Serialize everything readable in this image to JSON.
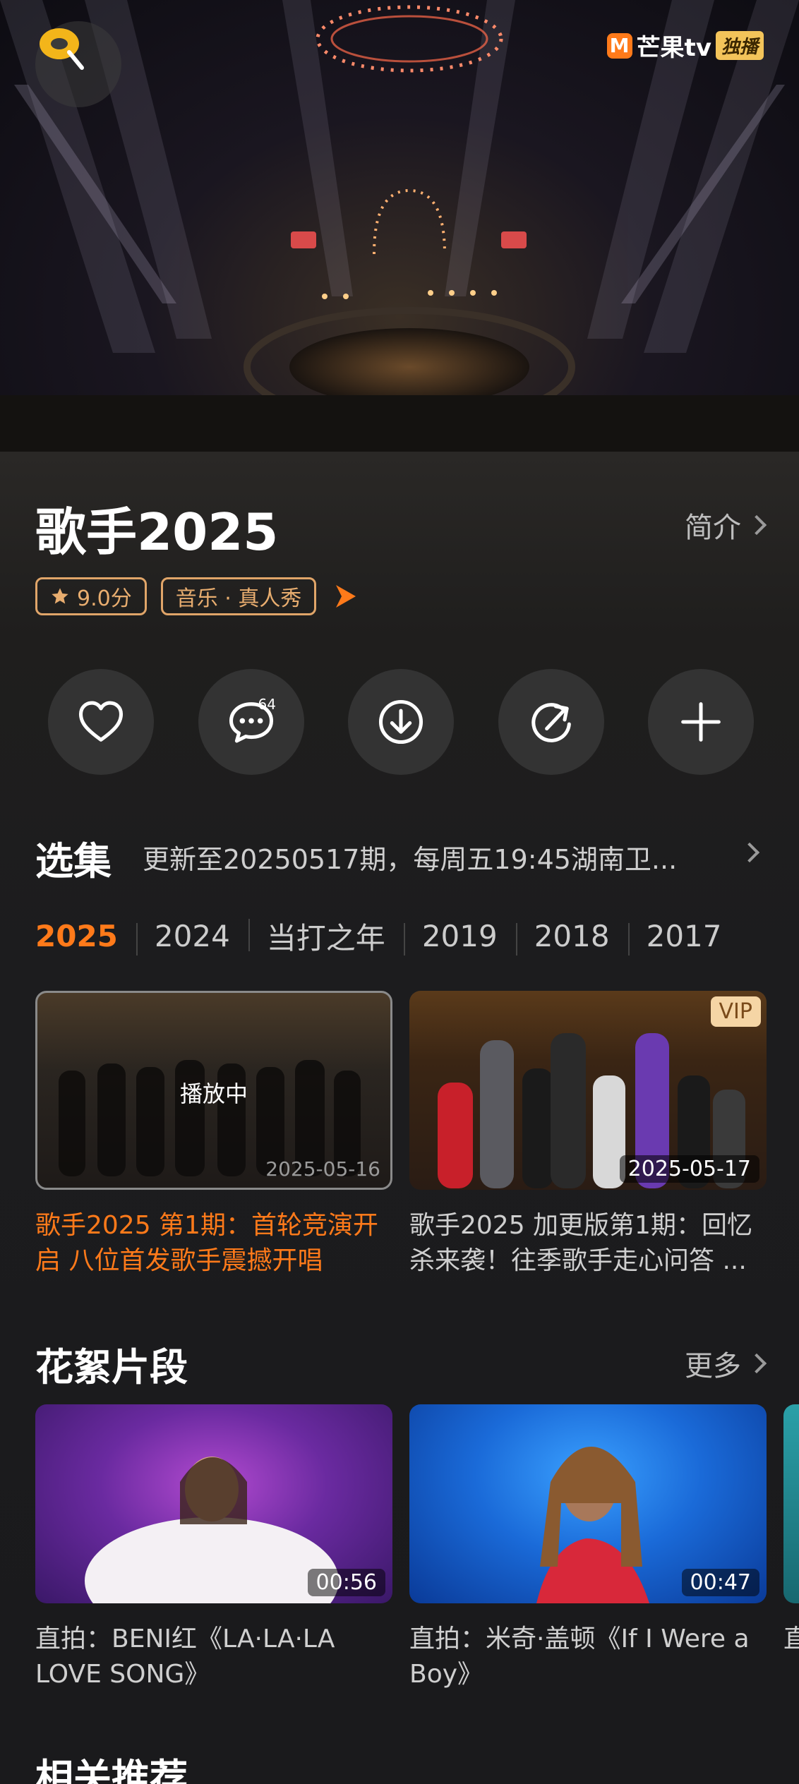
{
  "player": {
    "brand_letter": "M",
    "brand_name": "芒果tv",
    "brand_tag": "独播"
  },
  "show": {
    "title": "歌手2025",
    "intro_label": "简介",
    "rating": "9.0分",
    "genre": "音乐 · 真人秀"
  },
  "actions": {
    "comment_count": "64"
  },
  "episodes": {
    "section_title": "选集",
    "update_info": "更新至20250517期，每周五19:45湖南卫...",
    "years": [
      "2025",
      "2024",
      "当打之年",
      "2019",
      "2018",
      "2017"
    ],
    "active_year": "2025",
    "items": [
      {
        "status": "播放中",
        "date": "2025-05-16",
        "title": "歌手2025 第1期：首轮竞演开启 八位首发歌手震撼开唱"
      },
      {
        "badge": "VIP",
        "date": "2025-05-17",
        "title": "歌手2025 加更版第1期：回忆杀来袭！往季歌手走心问答 ..."
      }
    ]
  },
  "clips": {
    "section_title": "花絮片段",
    "more_label": "更多",
    "items": [
      {
        "duration": "00:56",
        "title": "直拍：BENI红《LA·LA·LA LOVE SONG》"
      },
      {
        "duration": "00:47",
        "title": "直拍：米奇·盖顿《If I Were a Boy》"
      },
      {
        "title": "直"
      }
    ]
  },
  "related": {
    "section_title": "相关推荐"
  },
  "colors": {
    "accent": "#ff7a1a",
    "tag_border": "#e0a569",
    "background": "#1d1d1f"
  }
}
